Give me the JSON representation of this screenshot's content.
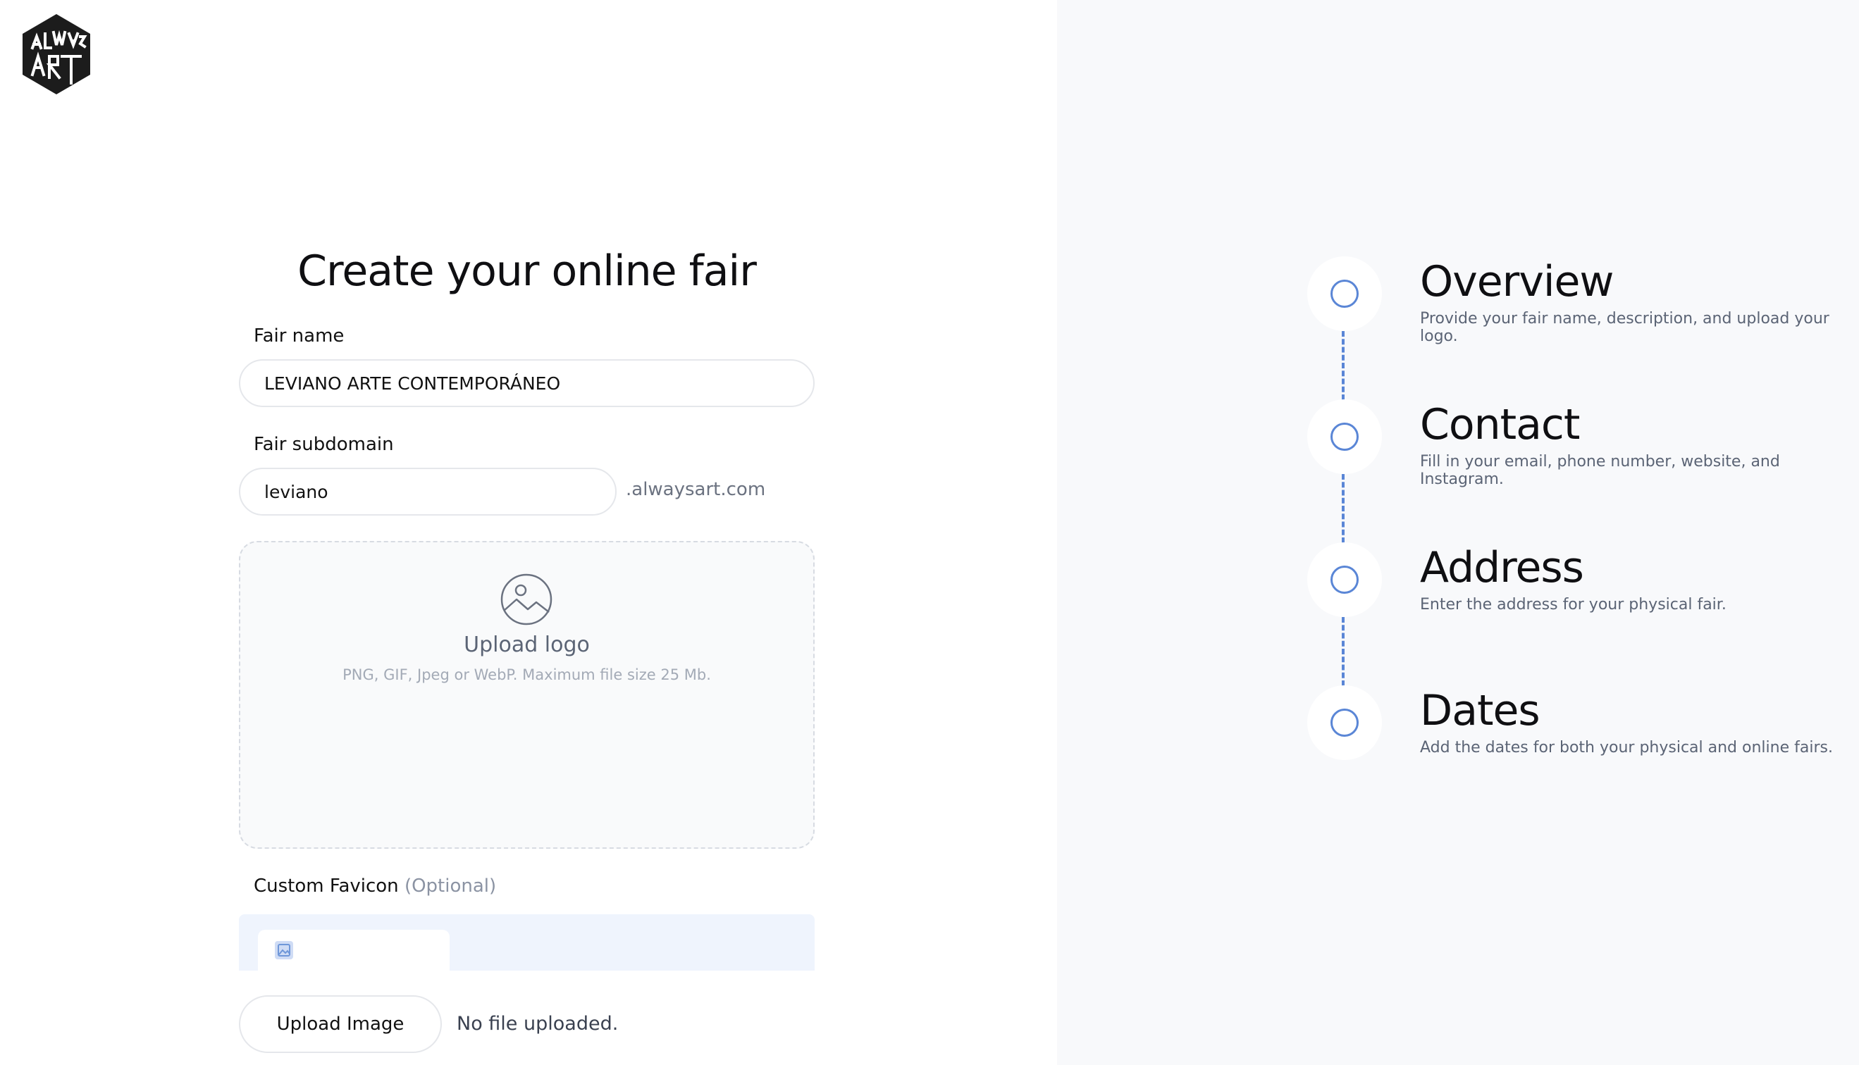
{
  "brand": {
    "logo_alt": "ALWAYS ART",
    "accent_color": "#5a86d6"
  },
  "page": {
    "title": "Create your online fair"
  },
  "form": {
    "fair_name": {
      "label": "Fair name",
      "value": "LEVIANO ARTE CONTEMPORÁNEO"
    },
    "fair_subdomain": {
      "label": "Fair subdomain",
      "value": "leviano",
      "suffix": ".alwaysart.com"
    },
    "logo_upload": {
      "title": "Upload logo",
      "hint": "PNG, GIF, Jpeg or WebP. Maximum file size 25 Mb.",
      "icon": "image-icon"
    },
    "favicon": {
      "label": "Custom Favicon",
      "optional_tag": "(Optional)",
      "button_label": "Upload Image",
      "status": "No file uploaded."
    }
  },
  "steps": [
    {
      "title": "Overview",
      "description": "Provide your fair name, description, and upload your logo."
    },
    {
      "title": "Contact",
      "description": "Fill in your email, phone number, website, and Instagram."
    },
    {
      "title": "Address",
      "description": "Enter the address for your physical fair."
    },
    {
      "title": "Dates",
      "description": "Add the dates for both your physical and online fairs."
    }
  ]
}
